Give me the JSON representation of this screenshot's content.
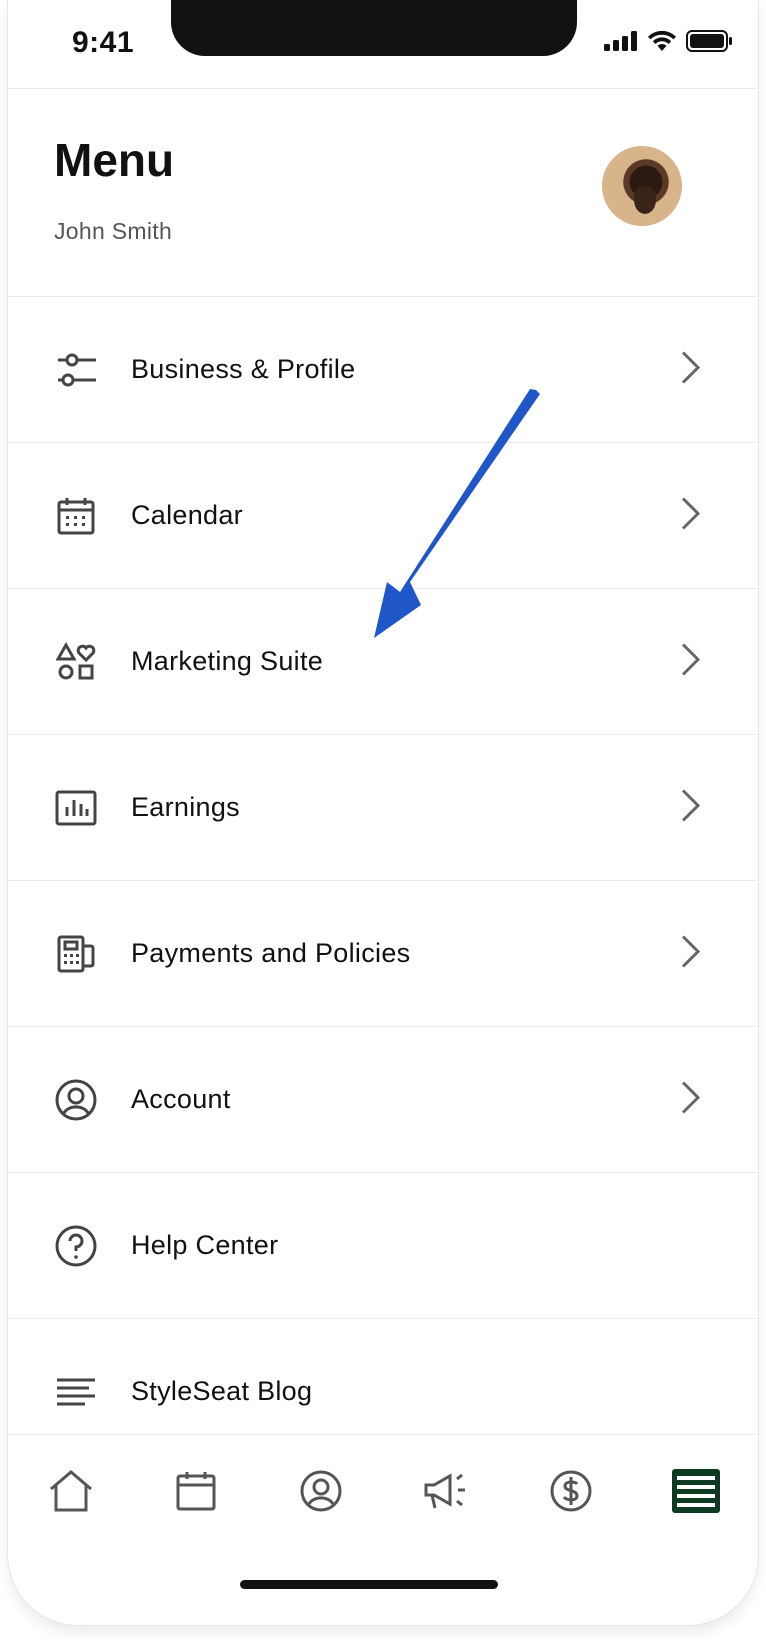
{
  "status_bar": {
    "time": "9:41"
  },
  "header": {
    "title": "Menu",
    "user_name": "John Smith"
  },
  "menu": {
    "items": [
      {
        "label": "Business & Profile",
        "icon": "sliders-icon",
        "has_chevron": true
      },
      {
        "label": "Calendar",
        "icon": "calendar-icon",
        "has_chevron": true
      },
      {
        "label": "Marketing Suite",
        "icon": "shapes-heart-icon",
        "has_chevron": true
      },
      {
        "label": "Earnings",
        "icon": "bar-chart-icon",
        "has_chevron": true
      },
      {
        "label": "Payments and Policies",
        "icon": "card-reader-icon",
        "has_chevron": true
      },
      {
        "label": "Account",
        "icon": "user-circle-icon",
        "has_chevron": true
      },
      {
        "label": "Help Center",
        "icon": "help-circle-icon",
        "has_chevron": false
      },
      {
        "label": "StyleSeat Blog",
        "icon": "text-lines-icon",
        "has_chevron": false
      }
    ]
  },
  "bottom_nav": [
    {
      "icon": "home-icon",
      "active": false
    },
    {
      "icon": "calendar-icon",
      "active": false
    },
    {
      "icon": "profile-icon",
      "active": false
    },
    {
      "icon": "megaphone-icon",
      "active": false
    },
    {
      "icon": "dollar-icon",
      "active": false
    },
    {
      "icon": "menu-icon",
      "active": true
    }
  ],
  "colors": {
    "accent": "#0d3b22",
    "icon": "#444444",
    "annotation_arrow": "#1f56c8"
  }
}
